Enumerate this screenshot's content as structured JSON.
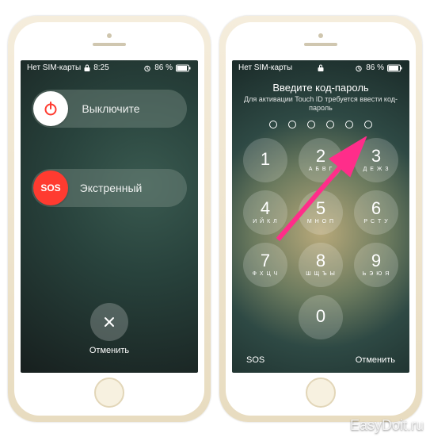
{
  "status": {
    "carrier": "Нет SIM-карты",
    "time": "8:25",
    "battery_pct": "86 %"
  },
  "power_screen": {
    "power_off_label": "Выключите",
    "sos_knob": "SOS",
    "sos_label": "Экстренный",
    "cancel": "Отменить"
  },
  "passcode_screen": {
    "title": "Введите код-пароль",
    "subtitle": "Для активации Touch ID требуется ввести код-пароль",
    "keys": [
      {
        "num": "1",
        "letters": ""
      },
      {
        "num": "2",
        "letters": "А Б В Г"
      },
      {
        "num": "3",
        "letters": "Д Е Ж З"
      },
      {
        "num": "4",
        "letters": "И Й К Л"
      },
      {
        "num": "5",
        "letters": "М Н О П"
      },
      {
        "num": "6",
        "letters": "Р С Т У"
      },
      {
        "num": "7",
        "letters": "Ф Х Ц Ч"
      },
      {
        "num": "8",
        "letters": "Ш Щ Ъ Ы"
      },
      {
        "num": "9",
        "letters": "Ь Э Ю Я"
      },
      {
        "num": "0",
        "letters": ""
      }
    ],
    "sos": "SOS",
    "cancel": "Отменить"
  },
  "watermark": "EasyDoit.ru"
}
